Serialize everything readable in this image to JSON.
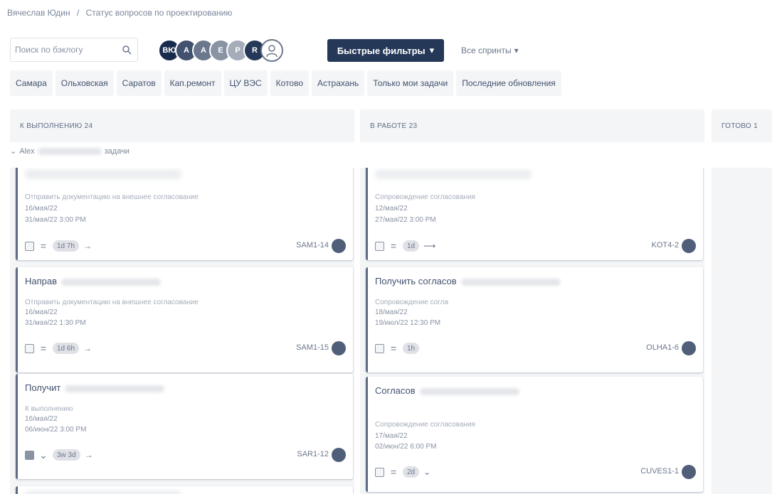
{
  "breadcrumb": {
    "user": "Вячеслав Юдин",
    "separator": "/",
    "project": "Статус вопросов по проектированию"
  },
  "toolbar": {
    "search_placeholder": "Поиск по бэклогу",
    "avatars": [
      {
        "label": "ВЮ",
        "color": "#172b4d"
      },
      {
        "label": "A",
        "color": "#42526e"
      },
      {
        "label": "A",
        "color": "#6b778c"
      },
      {
        "label": "E",
        "color": "#8993a4"
      },
      {
        "label": "P",
        "color": "#a5adba"
      },
      {
        "label": "R",
        "color": "#253858"
      },
      {
        "label": "",
        "color": "#c1c7d0"
      }
    ],
    "quick_filters_label": "Быстрые фильтры",
    "all_sprints_label": "Все спринты"
  },
  "filters": [
    "Самара",
    "Ольховская",
    "Саратов",
    "Кап.ремонт",
    "ЦУ ВЭС",
    "Котово",
    "Астрахань",
    "Только мои задачи",
    "Последние обновления"
  ],
  "columns": [
    {
      "title": "К ВЫПОЛНЕНИЮ 24"
    },
    {
      "title": "В РАБОТЕ 23"
    },
    {
      "title": "ГОТОВО 1"
    }
  ],
  "swimlane": {
    "label": "Alex",
    "suffix": "задачи"
  },
  "todo_cards": [
    {
      "title": "",
      "sub": "Отправить документацию на внешнее согласование",
      "date1": "16/мая/22",
      "date2": "31/мая/22 3:00 PM",
      "estimate": "1d 7h",
      "key": "SAM1-14",
      "type_checked": false
    },
    {
      "title": "Направ",
      "sub": "Отправить документацию на внешнее согласование",
      "date1": "16/мая/22",
      "date2": "31/мая/22 1:30 PM",
      "estimate": "1d 6h",
      "key": "SAM1-15",
      "type_checked": false
    },
    {
      "title": "Получит",
      "sub": "К выполнению",
      "date1": "16/мая/22",
      "date2": "06/июн/22 3:00 PM",
      "estimate": "3w 3d",
      "key": "SAR1-12",
      "type_checked": true
    }
  ],
  "inprogress_cards": [
    {
      "title": "",
      "sub": "Сопровождение согласования",
      "date1": "12/мая/22",
      "date2": "27/мая/22 3:00 PM",
      "estimate": "1d",
      "key": "KOT4-2"
    },
    {
      "title": "Получить согласов",
      "sub": "Сопровождение согла",
      "date1": "18/мая/22",
      "date2": "19/июл/22 12:30 PM",
      "estimate": "1h",
      "key": "OLHA1-6"
    },
    {
      "title": "Согласов",
      "sub": "Сопровождение согласования",
      "date1": "17/мая/22",
      "date2": "02/июн/22 6:00 PM",
      "estimate": "2d",
      "key": "CUVES1-1"
    }
  ],
  "icons": {
    "search": "search-icon",
    "chevron": "chevron-down-icon",
    "priority_medium": "priority-medium-icon",
    "priority_low": "priority-low-icon",
    "arrow": "arrow-right-icon"
  }
}
